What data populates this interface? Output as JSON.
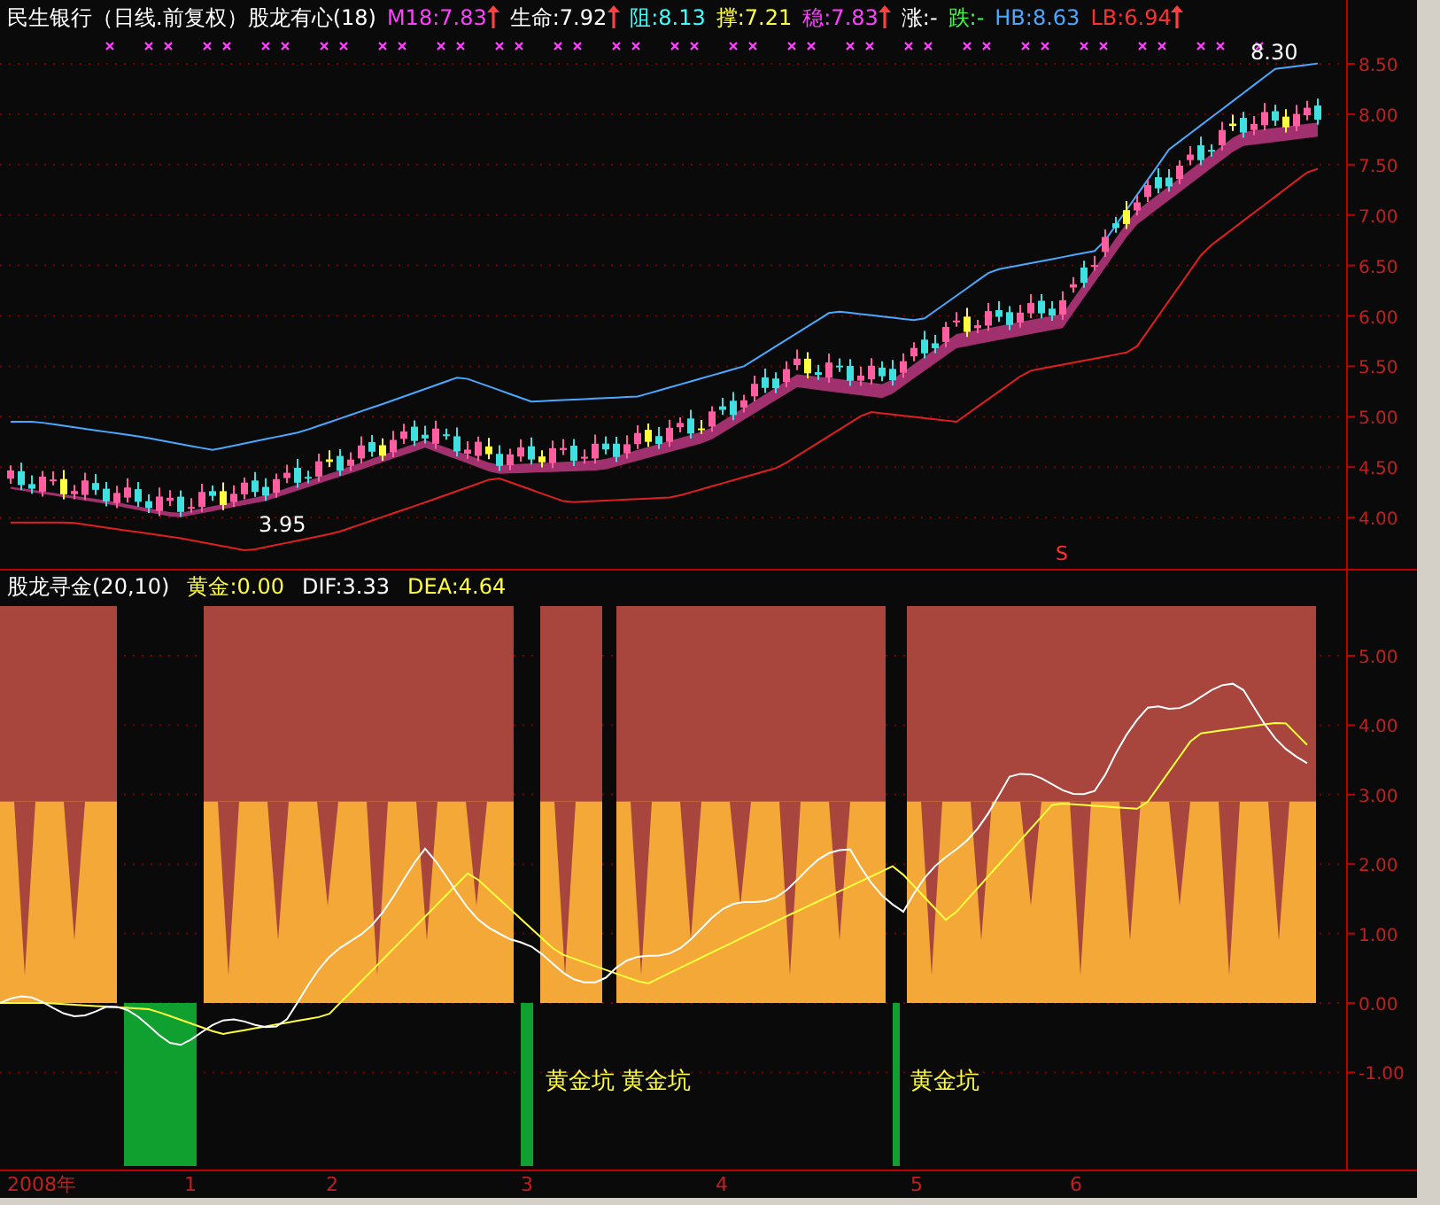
{
  "upper_panel": {
    "header": [
      {
        "text": "民生银行（日线.前复权）股龙有心(18)",
        "color": "#ffffff",
        "arrow": false
      },
      {
        "text": "M18:7.83",
        "color": "#ff40ff",
        "arrow": true
      },
      {
        "text": "生命:7.92",
        "color": "#ffffff",
        "arrow": true
      },
      {
        "text": "阻:8.13",
        "color": "#40ffff",
        "arrow": false
      },
      {
        "text": "撑:7.21",
        "color": "#ffff40",
        "arrow": false
      },
      {
        "text": "稳:7.83",
        "color": "#ff40ff",
        "arrow": true
      },
      {
        "text": "涨:-",
        "color": "#ffffff",
        "arrow": false
      },
      {
        "text": "跌:-",
        "color": "#40ff40",
        "arrow": false
      },
      {
        "text": "HB:8.63",
        "color": "#4aa8ff",
        "arrow": false
      },
      {
        "text": "LB:6.94",
        "color": "#ff3030",
        "arrow": true
      }
    ],
    "annotations": [
      "8.30",
      "3.95"
    ],
    "signal_mark": "S",
    "y_axis": [
      "8.50",
      "8.00",
      "7.50",
      "7.00",
      "6.50",
      "6.00",
      "5.50",
      "5.00",
      "4.50",
      "4.00"
    ]
  },
  "lower_panel": {
    "header": [
      {
        "text": "股龙寻金(20,10)",
        "color": "#ffffff"
      },
      {
        "text": "黄金:0.00",
        "color": "#ffff40"
      },
      {
        "text": "DIF:3.33",
        "color": "#ffffff"
      },
      {
        "text": "DEA:4.64",
        "color": "#ffff40"
      }
    ],
    "labels": [
      "黄金坑",
      "黄金坑",
      "黄金坑"
    ],
    "y_axis": [
      "5.00",
      "4.00",
      "3.00",
      "2.00",
      "1.00",
      "0.00",
      "-1.00"
    ]
  },
  "x_axis": [
    "2008年",
    "1",
    "2",
    "3",
    "4",
    "5",
    "6"
  ]
}
